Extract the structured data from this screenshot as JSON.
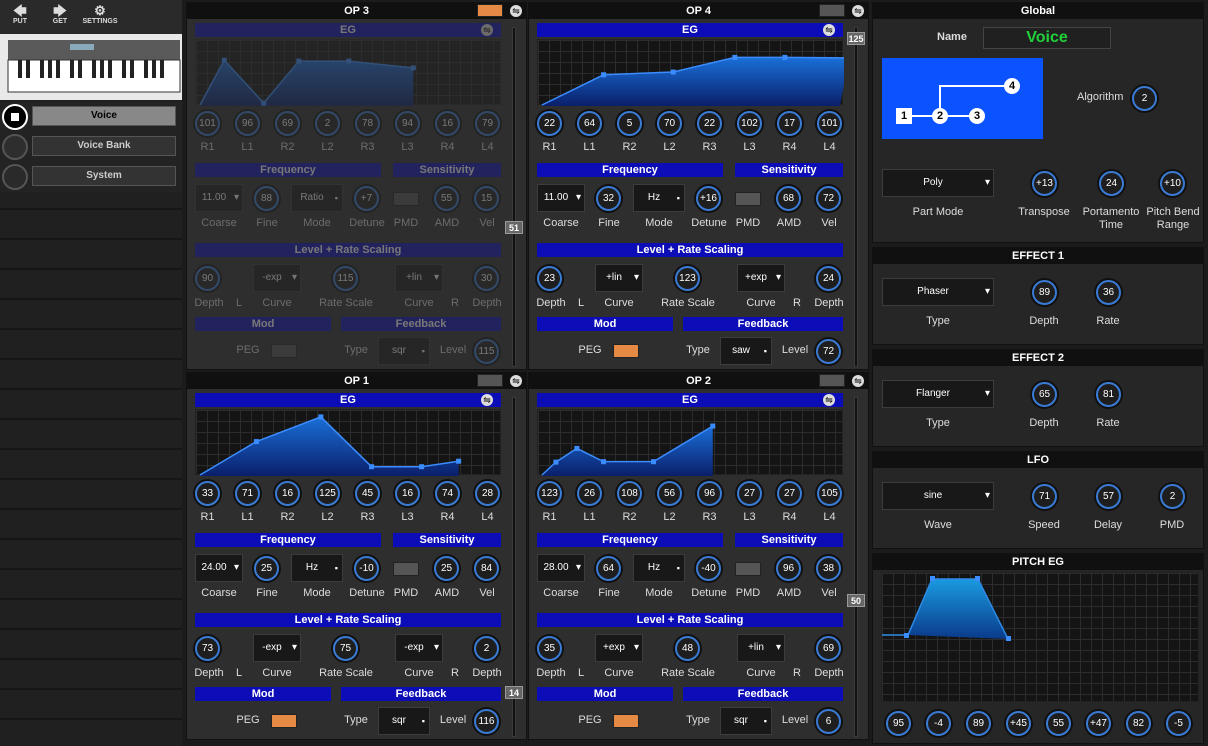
{
  "toolbar": {
    "put": "PUT",
    "get": "GET",
    "settings": "SETTINGS"
  },
  "nav": {
    "voice": "Voice",
    "voice_bank": "Voice Bank",
    "system": "System"
  },
  "ops": {
    "op3": {
      "title": "OP 3",
      "eg": "EG",
      "r1": "101",
      "l1": "96",
      "r2": "69",
      "l2": "2",
      "r3": "78",
      "l3": "94",
      "r4": "16",
      "l4": "79",
      "coarse": "11.00",
      "fine": "88",
      "mode": "Ratio",
      "detune": "+7",
      "amd": "55",
      "vel": "15",
      "ldepth": "90",
      "lcurve": "-exp",
      "ratescale": "115",
      "rcurve": "+lin",
      "rdepth": "30",
      "fbtype": "sqr",
      "fblevel": "115",
      "slider": "51"
    },
    "op4": {
      "title": "OP 4",
      "eg": "EG",
      "r1": "22",
      "l1": "64",
      "r2": "5",
      "l2": "70",
      "r3": "22",
      "l3": "102",
      "r4": "17",
      "l4": "101",
      "coarse": "11.00",
      "fine": "32",
      "mode": "Hz",
      "detune": "+16",
      "amd": "68",
      "vel": "72",
      "ldepth": "23",
      "lcurve": "+lin",
      "ratescale": "123",
      "rcurve": "+exp",
      "rdepth": "24",
      "fbtype": "saw",
      "fblevel": "72",
      "slider": "125"
    },
    "op1": {
      "title": "OP 1",
      "eg": "EG",
      "r1": "33",
      "l1": "71",
      "r2": "16",
      "l2": "125",
      "r3": "45",
      "l3": "16",
      "r4": "74",
      "l4": "28",
      "coarse": "24.00",
      "fine": "25",
      "mode": "Hz",
      "detune": "-10",
      "amd": "25",
      "vel": "84",
      "ldepth": "73",
      "lcurve": "-exp",
      "ratescale": "75",
      "rcurve": "-exp",
      "rdepth": "2",
      "fbtype": "sqr",
      "fblevel": "116",
      "slider": "14"
    },
    "op2": {
      "title": "OP 2",
      "eg": "EG",
      "r1": "123",
      "l1": "26",
      "r2": "108",
      "l2": "56",
      "r3": "96",
      "l3": "27",
      "r4": "27",
      "l4": "105",
      "coarse": "28.00",
      "fine": "64",
      "mode": "Hz",
      "detune": "-40",
      "amd": "96",
      "vel": "38",
      "ldepth": "35",
      "lcurve": "+exp",
      "ratescale": "48",
      "rcurve": "+lin",
      "rdepth": "69",
      "fbtype": "sqr",
      "fblevel": "6",
      "slider": "50"
    }
  },
  "oplabels": {
    "r1": "R1",
    "l1": "L1",
    "r2": "R2",
    "l2": "L2",
    "r3": "R3",
    "l3": "L3",
    "r4": "R4",
    "l4": "L4",
    "frequency": "Frequency",
    "sensitivity": "Sensitivity",
    "coarse": "Coarse",
    "fine": "Fine",
    "mode": "Mode",
    "detune": "Detune",
    "pmd": "PMD",
    "amd": "AMD",
    "vel": "Vel",
    "lrs": "Level + Rate Scaling",
    "depth": "Depth",
    "l": "L",
    "curve": "Curve",
    "ratescale": "Rate Scale",
    "r": "R",
    "mod": "Mod",
    "feedback": "Feedback",
    "peg": "PEG",
    "type": "Type",
    "level": "Level"
  },
  "global": {
    "title": "Global",
    "name_label": "Name",
    "name_value": "Voice",
    "algorithm_label": "Algorithm",
    "algorithm": "2",
    "part_mode": "Poly",
    "part_mode_label": "Part Mode",
    "transpose": "+13",
    "transpose_label": "Transpose",
    "portamento": "24",
    "portamento_label": "Portamento Time",
    "pitchbend": "+10",
    "pitchbend_label": "Pitch Bend Range",
    "nodes": [
      "1",
      "2",
      "3",
      "4"
    ]
  },
  "effect1": {
    "title": "EFFECT 1",
    "type": "Phaser",
    "depth": "89",
    "rate": "36",
    "type_label": "Type",
    "depth_label": "Depth",
    "rate_label": "Rate"
  },
  "effect2": {
    "title": "EFFECT 2",
    "type": "Flanger",
    "depth": "65",
    "rate": "81",
    "type_label": "Type",
    "depth_label": "Depth",
    "rate_label": "Rate"
  },
  "lfo": {
    "title": "LFO",
    "wave": "sine",
    "speed": "71",
    "delay": "57",
    "pmd": "2",
    "wave_label": "Wave",
    "speed_label": "Speed",
    "delay_label": "Delay",
    "pmd_label": "PMD"
  },
  "pitcheg": {
    "title": "PITCH EG",
    "knobs": [
      "95",
      "-4",
      "89",
      "+45",
      "55",
      "+47",
      "82",
      "-5"
    ]
  },
  "colors": {
    "accent": "#0d0db8",
    "knob_ring": "#3a7bd5",
    "name_text": "#22d03a",
    "led_on": "#e48a44"
  }
}
